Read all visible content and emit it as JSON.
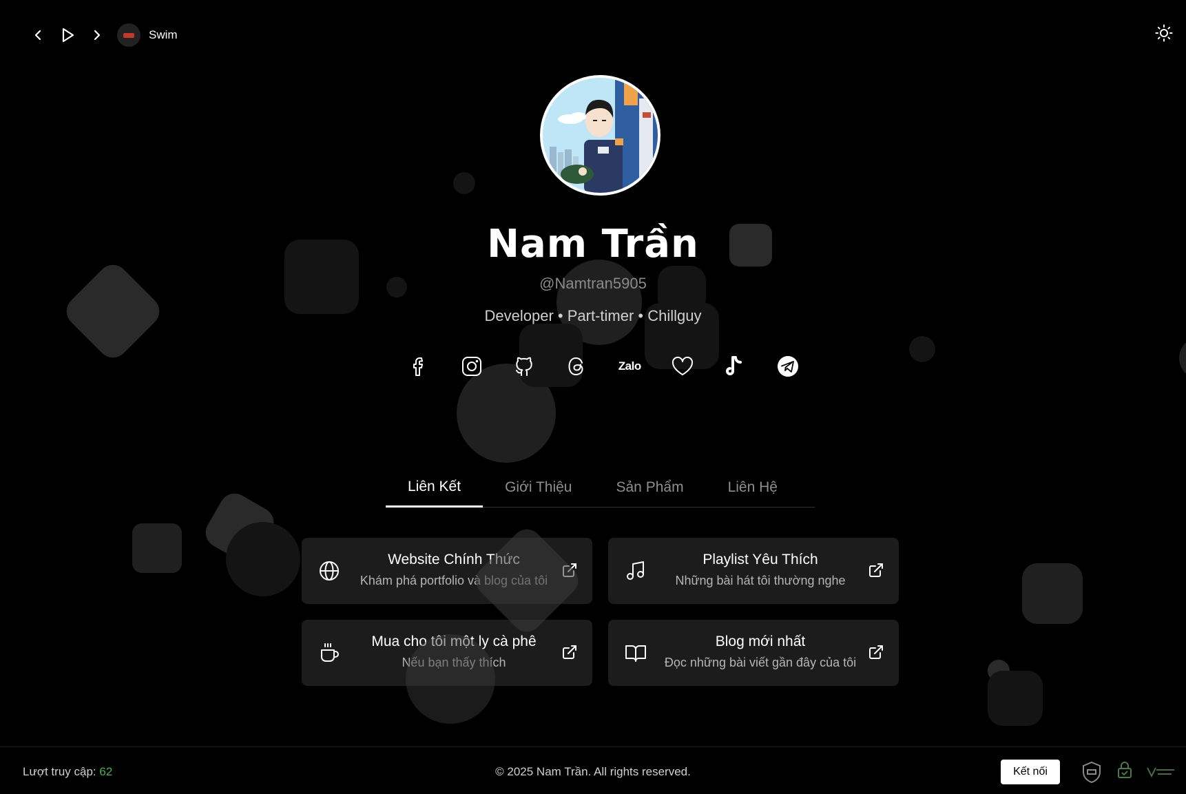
{
  "player": {
    "track_title": "Swim",
    "prev_icon": "chevron-left-icon",
    "play_icon": "play-icon",
    "next_icon": "chevron-right-icon"
  },
  "theme_toggle_icon": "sun-icon",
  "profile": {
    "name": "Nam Trần",
    "handle": "@Namtran5905",
    "bio": "Developer • Part-timer • Chillguy"
  },
  "socials": [
    {
      "icon": "facebook-icon"
    },
    {
      "icon": "instagram-icon"
    },
    {
      "icon": "github-icon"
    },
    {
      "icon": "threads-icon"
    },
    {
      "icon": "zalo-icon",
      "label": "Zalo"
    },
    {
      "icon": "heart-icon"
    },
    {
      "icon": "tiktok-icon"
    },
    {
      "icon": "telegram-icon"
    }
  ],
  "tabs": [
    {
      "label": "Liên Kết",
      "active": true
    },
    {
      "label": "Giới Thiệu",
      "active": false
    },
    {
      "label": "Sản Phẩm",
      "active": false
    },
    {
      "label": "Liên Hệ",
      "active": false
    }
  ],
  "cards": [
    {
      "icon": "globe-icon",
      "title": "Website Chính Thức",
      "subtitle": "Khám phá portfolio và blog của tôi"
    },
    {
      "icon": "music-icon",
      "title": "Playlist Yêu Thích",
      "subtitle": "Những bài hát tôi thường nghe"
    },
    {
      "icon": "coffee-icon",
      "title": "Mua cho tôi một ly cà phê",
      "subtitle": "Nếu bạn thấy thích"
    },
    {
      "icon": "book-icon",
      "title": "Blog mới nhất",
      "subtitle": "Đọc những bài viết gần đây của tôi"
    }
  ],
  "footer": {
    "visits_label": "Lượt truy cập:",
    "visits_count": "62",
    "copyright": "© 2025 Nam Trần. All rights reserved.",
    "connect_label": "Kết nối",
    "badges": [
      "shield-badge-icon",
      "ssl-lock-icon",
      "verified-badge-icon"
    ]
  },
  "colors": {
    "background": "#000000",
    "card_bg": "#1e1e1e",
    "visits_count": "#4caf50",
    "muted_text": "#8f8f8f"
  }
}
